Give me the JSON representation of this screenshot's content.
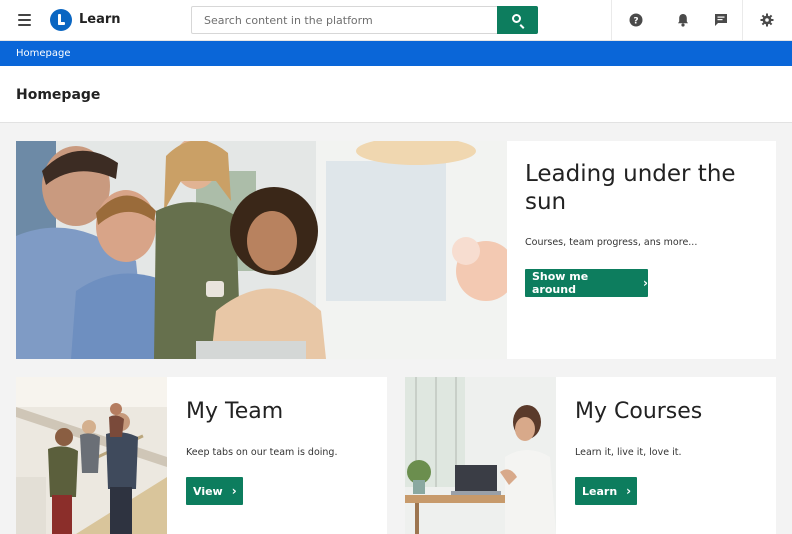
{
  "app": {
    "brand": "Learn"
  },
  "search": {
    "placeholder": "Search content in the platform"
  },
  "breadcrumb": {
    "current": "Homepage"
  },
  "page": {
    "title": "Homepage"
  },
  "hero": {
    "title": "Leading under the sun",
    "subtitle": "Courses, team progress, ans more...",
    "button_label": "Show me around"
  },
  "cards": [
    {
      "title": "My Team",
      "text": "Keep tabs on our team is doing.",
      "button_label": "View"
    },
    {
      "title": "My Courses",
      "text": "Learn it, live it, love it.",
      "button_label": "Learn"
    }
  ],
  "icons": {
    "menu": "hamburger-icon",
    "logo": "learn-logo-icon",
    "search": "search-icon",
    "help": "help-circle-icon",
    "notifications": "bell-icon",
    "messages": "chat-icon",
    "settings": "gear-icon",
    "chevron": "chevron-right-icon"
  },
  "colors": {
    "accent_green": "#0d7d5e",
    "breadcrumb_blue": "#0a66d8",
    "logo_blue": "#0a66c2"
  }
}
